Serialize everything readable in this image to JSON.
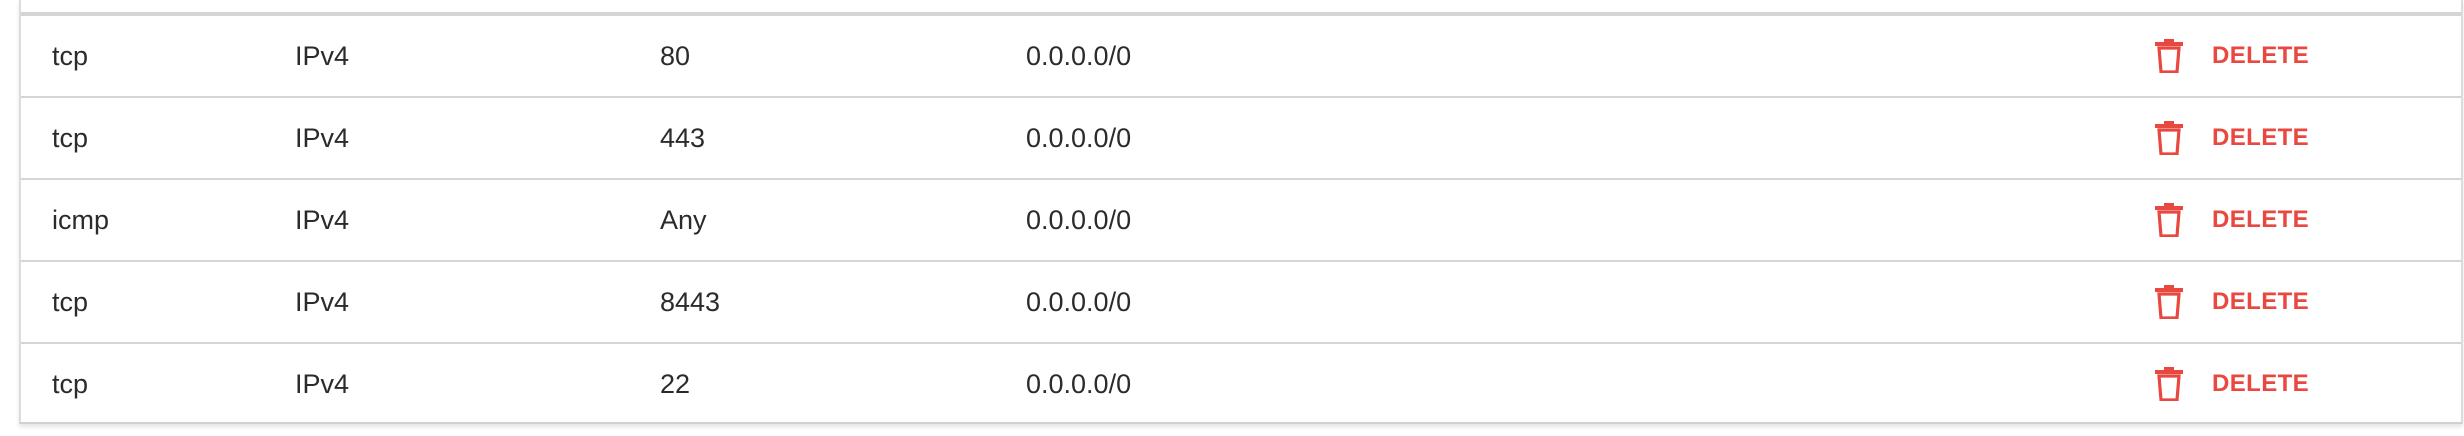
{
  "table": {
    "rows": [
      {
        "protocol": "tcp",
        "ip_version": "IPv4",
        "port": "80",
        "source": "0.0.0.0/0",
        "action_label": "DELETE",
        "action_icon": "trash-icon"
      },
      {
        "protocol": "tcp",
        "ip_version": "IPv4",
        "port": "443",
        "source": "0.0.0.0/0",
        "action_label": "DELETE",
        "action_icon": "trash-icon"
      },
      {
        "protocol": "icmp",
        "ip_version": "IPv4",
        "port": "Any",
        "source": "0.0.0.0/0",
        "action_label": "DELETE",
        "action_icon": "trash-icon"
      },
      {
        "protocol": "tcp",
        "ip_version": "IPv4",
        "port": "8443",
        "source": "0.0.0.0/0",
        "action_label": "DELETE",
        "action_icon": "trash-icon"
      },
      {
        "protocol": "tcp",
        "ip_version": "IPv4",
        "port": "22",
        "source": "0.0.0.0/0",
        "action_label": "DELETE",
        "action_icon": "trash-icon"
      }
    ]
  },
  "colors": {
    "delete_accent": "#e8483f",
    "text": "#2b2b2b",
    "divider": "#d5d5d5"
  }
}
